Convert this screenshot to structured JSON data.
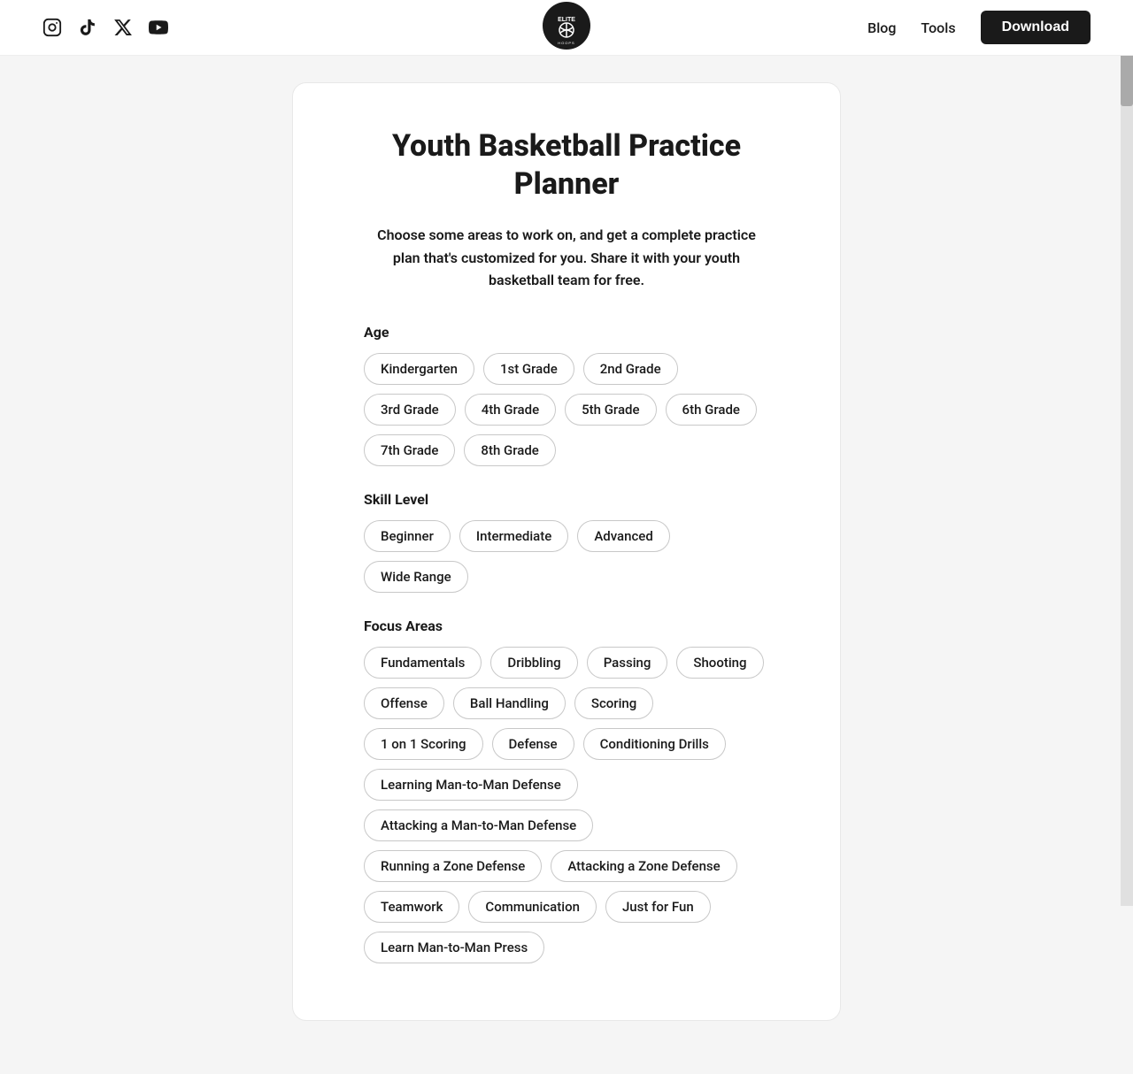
{
  "navbar": {
    "social_icons": [
      {
        "name": "instagram-icon",
        "symbol": "📷",
        "label": "Instagram"
      },
      {
        "name": "tiktok-icon",
        "symbol": "♪",
        "label": "TikTok"
      },
      {
        "name": "twitter-icon",
        "symbol": "𝕏",
        "label": "Twitter"
      },
      {
        "name": "youtube-icon",
        "symbol": "▶",
        "label": "YouTube"
      }
    ],
    "nav_links": [
      {
        "name": "blog-link",
        "label": "Blog"
      },
      {
        "name": "tools-link",
        "label": "Tools"
      }
    ],
    "download_button": "Download"
  },
  "card": {
    "title": "Youth Basketball Practice Planner",
    "description": "Choose some areas to work on, and get a complete practice plan that's customized for you. Share it with your youth basketball team for free.",
    "age_label": "Age",
    "age_tags": [
      "Kindergarten",
      "1st Grade",
      "2nd Grade",
      "3rd Grade",
      "4th Grade",
      "5th Grade",
      "6th Grade",
      "7th Grade",
      "8th Grade"
    ],
    "skill_label": "Skill Level",
    "skill_tags": [
      "Beginner",
      "Intermediate",
      "Advanced",
      "Wide Range"
    ],
    "focus_label": "Focus Areas",
    "focus_tags": [
      "Fundamentals",
      "Dribbling",
      "Passing",
      "Shooting",
      "Offense",
      "Ball Handling",
      "Scoring",
      "1 on 1 Scoring",
      "Defense",
      "Conditioning Drills",
      "Learning Man-to-Man Defense",
      "Attacking a Man-to-Man Defense",
      "Running a Zone Defense",
      "Attacking a Zone Defense",
      "Teamwork",
      "Communication",
      "Just for Fun",
      "Learn Man-to-Man Press"
    ]
  }
}
